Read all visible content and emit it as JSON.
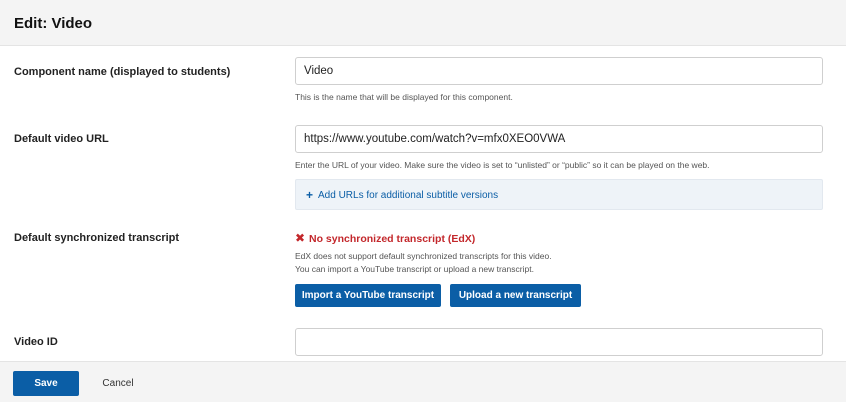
{
  "header": {
    "title": "Edit: Video"
  },
  "fields": {
    "component_name": {
      "label": "Component name (displayed to students)",
      "value": "Video",
      "help": "This is the name that will be displayed for this component."
    },
    "default_video_url": {
      "label": "Default video URL",
      "value": "https://www.youtube.com/watch?v=mfx0XEO0VWA",
      "help": "Enter the URL of your video. Make sure the video is set to “unlisted” or “public” so it can be played on the web.",
      "add_subtitles_label": "Add URLs for additional subtitle versions"
    },
    "transcript": {
      "label": "Default synchronized transcript",
      "error": "No synchronized transcript (EdX)",
      "help_line1": "EdX does not support default synchronized transcripts for this video.",
      "help_line2": "You can import a YouTube transcript or upload a new transcript.",
      "import_button": "Import a YouTube transcript",
      "upload_button": "Upload a new transcript"
    },
    "video_id": {
      "label": "Video ID",
      "value": ""
    }
  },
  "footer": {
    "save_label": "Save",
    "cancel_label": "Cancel"
  },
  "icons": {
    "plus": "+",
    "error_x": "✖"
  },
  "colors": {
    "primary": "#0b5ea6",
    "error": "#c3272b",
    "header_bg": "#f4f4f4",
    "subtitle_box_bg": "#eef3f8"
  }
}
